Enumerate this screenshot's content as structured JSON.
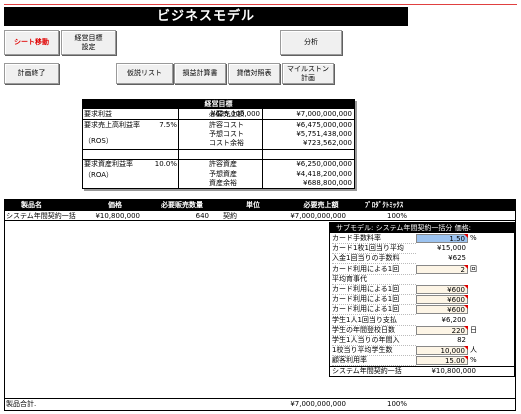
{
  "header": {
    "title": "ビジネスモデル"
  },
  "toolbar": {
    "row1": [
      "シート移動",
      "経営目標\n設定",
      "分析"
    ],
    "row2": [
      "計画終了",
      "仮説リスト",
      "損益計算書",
      "貸借対照表",
      "マイルストン\n計画"
    ]
  },
  "mgmt": {
    "title": "経営目標",
    "target_profit_label": "要求利益",
    "target_profit": "¥625,000,000",
    "req_sales_label": "必要売上額",
    "req_sales": "¥7,000,000,000",
    "ros_label": "要求売上高利益率",
    "ros_sub": "（ROS）",
    "ros_value": "7.5%",
    "variable_cost_label": "許容コスト",
    "variable_cost": "¥6,475,000,000",
    "expected_cost_label": "予想コスト",
    "expected_cost": "¥5,751,438,000",
    "cost_margin_label": "コスト余裕",
    "cost_margin": "¥723,562,000",
    "roa_label": "要求資産利益率",
    "roa_sub": "（ROA）",
    "roa_value": "10.0%",
    "allowed_assets_label": "許容資産",
    "allowed_assets": "¥6,250,000,000",
    "expected_assets_label": "予想資産",
    "expected_assets": "¥4,418,200,000",
    "asset_margin_label": "資産余裕",
    "asset_margin": "¥688,800,000"
  },
  "products": {
    "headers": [
      "製品名",
      "価格",
      "必要販売数量",
      "単位",
      "必要売上額",
      "ﾌﾟﾛﾀﾞｸﾄﾐｯｸｽ"
    ],
    "rows": [
      {
        "name": "システム年間契約一括",
        "price": "¥10,800,000",
        "qty": "640",
        "unit": "契約",
        "sales": "¥7,000,000,000",
        "mix": "100%"
      }
    ],
    "total_label": "製品合計.",
    "total_sales": "¥7,000,000,000",
    "total_mix": "100%"
  },
  "submodel": {
    "title": "サブモデル: システム年間契約一括分 価格:",
    "rows": [
      {
        "label": "カード手数料率",
        "value": "1.50",
        "unit": "%",
        "style": "blue"
      },
      {
        "label": "カード1枚1回当り平均",
        "value": "¥15,000",
        "unit": "",
        "style": "plain"
      },
      {
        "label": "入金1回当りの手数料",
        "value": "¥625",
        "unit": "",
        "style": "plain"
      },
      {
        "label": "カード利用による1回",
        "value": "2",
        "unit": "回",
        "style": "input"
      },
      {
        "label": "平均育事代",
        "value": "",
        "unit": "",
        "style": "plain"
      },
      {
        "label": "カード利用による1回",
        "value": "¥600",
        "unit": "",
        "style": "input"
      },
      {
        "label": "カード利用による1回",
        "value": "¥600",
        "unit": "",
        "style": "input"
      },
      {
        "label": "カード利用による1回",
        "value": "¥600",
        "unit": "",
        "style": "input"
      },
      {
        "label": "学生1人1回当り支払",
        "value": "¥6,200",
        "unit": "",
        "style": "plain"
      },
      {
        "label": "学生の年間登校日数",
        "value": "220",
        "unit": "日",
        "style": "input"
      },
      {
        "label": "学生1人当りの年間入",
        "value": "82",
        "unit": "",
        "style": "plain"
      },
      {
        "label": "1校当り平均学生数",
        "value": "10,000",
        "unit": "人",
        "style": "input"
      },
      {
        "label": "顧客利用率",
        "value": "15.00",
        "unit": "%",
        "style": "input"
      }
    ],
    "result_label": "システム年間契約一括",
    "result_value": "¥10,800,000"
  }
}
